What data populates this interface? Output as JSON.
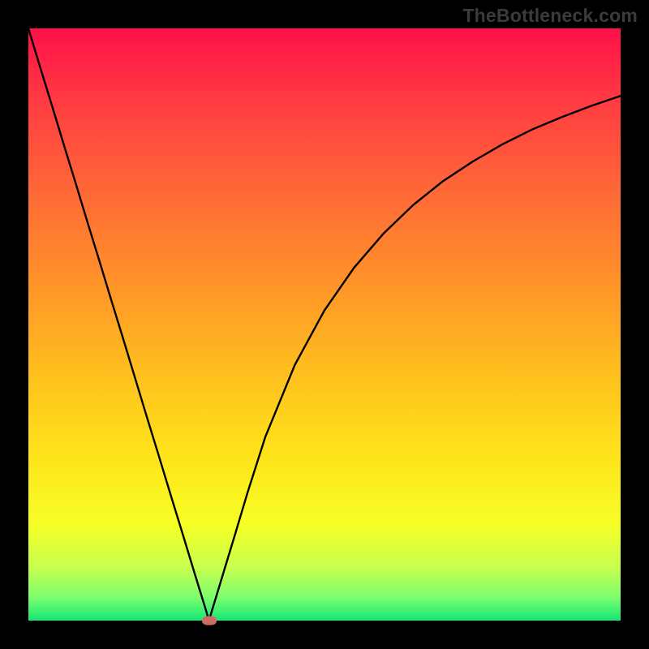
{
  "watermark": "TheBottleneck.com",
  "colors": {
    "frame": "#000000",
    "curve": "#000000",
    "marker": "#cf6a63",
    "gradient_top": "#ff1049",
    "gradient_bottom": "#14e676"
  },
  "chart_data": {
    "type": "line",
    "title": "",
    "xlabel": "",
    "ylabel": "",
    "xlim": [
      0,
      1
    ],
    "ylim": [
      0,
      1
    ],
    "x": [
      0.0,
      0.02,
      0.04,
      0.06,
      0.08,
      0.1,
      0.12,
      0.14,
      0.16,
      0.18,
      0.2,
      0.22,
      0.24,
      0.26,
      0.28,
      0.3,
      0.305,
      0.31,
      0.32,
      0.33,
      0.35,
      0.37,
      0.4,
      0.45,
      0.5,
      0.55,
      0.6,
      0.65,
      0.7,
      0.75,
      0.8,
      0.85,
      0.9,
      0.95,
      1.0
    ],
    "y": [
      1.0,
      0.934,
      0.869,
      0.803,
      0.738,
      0.672,
      0.607,
      0.541,
      0.476,
      0.41,
      0.344,
      0.279,
      0.213,
      0.148,
      0.082,
      0.017,
      0.0,
      0.017,
      0.05,
      0.083,
      0.149,
      0.216,
      0.31,
      0.432,
      0.524,
      0.596,
      0.654,
      0.702,
      0.742,
      0.775,
      0.804,
      0.829,
      0.85,
      0.869,
      0.886
    ],
    "marker": {
      "x": 0.305,
      "y": 0.0
    },
    "legend": []
  }
}
